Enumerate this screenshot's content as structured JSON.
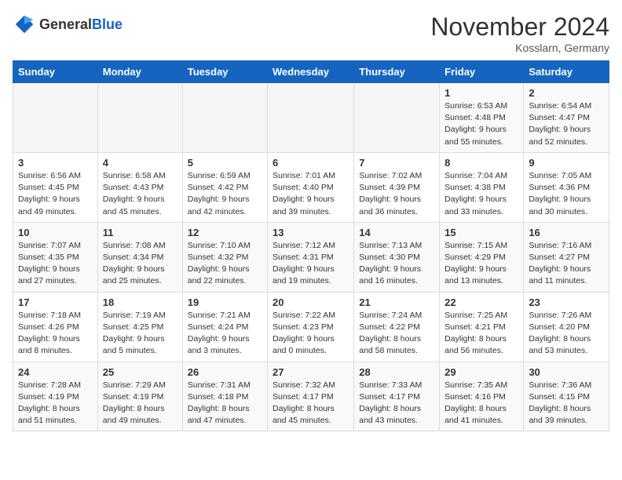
{
  "logo": {
    "general": "General",
    "blue": "Blue"
  },
  "title": "November 2024",
  "location": "Kosslarn, Germany",
  "weekdays": [
    "Sunday",
    "Monday",
    "Tuesday",
    "Wednesday",
    "Thursday",
    "Friday",
    "Saturday"
  ],
  "weeks": [
    [
      {
        "day": "",
        "info": ""
      },
      {
        "day": "",
        "info": ""
      },
      {
        "day": "",
        "info": ""
      },
      {
        "day": "",
        "info": ""
      },
      {
        "day": "",
        "info": ""
      },
      {
        "day": "1",
        "info": "Sunrise: 6:53 AM\nSunset: 4:48 PM\nDaylight: 9 hours and 55 minutes."
      },
      {
        "day": "2",
        "info": "Sunrise: 6:54 AM\nSunset: 4:47 PM\nDaylight: 9 hours and 52 minutes."
      }
    ],
    [
      {
        "day": "3",
        "info": "Sunrise: 6:56 AM\nSunset: 4:45 PM\nDaylight: 9 hours and 49 minutes."
      },
      {
        "day": "4",
        "info": "Sunrise: 6:58 AM\nSunset: 4:43 PM\nDaylight: 9 hours and 45 minutes."
      },
      {
        "day": "5",
        "info": "Sunrise: 6:59 AM\nSunset: 4:42 PM\nDaylight: 9 hours and 42 minutes."
      },
      {
        "day": "6",
        "info": "Sunrise: 7:01 AM\nSunset: 4:40 PM\nDaylight: 9 hours and 39 minutes."
      },
      {
        "day": "7",
        "info": "Sunrise: 7:02 AM\nSunset: 4:39 PM\nDaylight: 9 hours and 36 minutes."
      },
      {
        "day": "8",
        "info": "Sunrise: 7:04 AM\nSunset: 4:38 PM\nDaylight: 9 hours and 33 minutes."
      },
      {
        "day": "9",
        "info": "Sunrise: 7:05 AM\nSunset: 4:36 PM\nDaylight: 9 hours and 30 minutes."
      }
    ],
    [
      {
        "day": "10",
        "info": "Sunrise: 7:07 AM\nSunset: 4:35 PM\nDaylight: 9 hours and 27 minutes."
      },
      {
        "day": "11",
        "info": "Sunrise: 7:08 AM\nSunset: 4:34 PM\nDaylight: 9 hours and 25 minutes."
      },
      {
        "day": "12",
        "info": "Sunrise: 7:10 AM\nSunset: 4:32 PM\nDaylight: 9 hours and 22 minutes."
      },
      {
        "day": "13",
        "info": "Sunrise: 7:12 AM\nSunset: 4:31 PM\nDaylight: 9 hours and 19 minutes."
      },
      {
        "day": "14",
        "info": "Sunrise: 7:13 AM\nSunset: 4:30 PM\nDaylight: 9 hours and 16 minutes."
      },
      {
        "day": "15",
        "info": "Sunrise: 7:15 AM\nSunset: 4:29 PM\nDaylight: 9 hours and 13 minutes."
      },
      {
        "day": "16",
        "info": "Sunrise: 7:16 AM\nSunset: 4:27 PM\nDaylight: 9 hours and 11 minutes."
      }
    ],
    [
      {
        "day": "17",
        "info": "Sunrise: 7:18 AM\nSunset: 4:26 PM\nDaylight: 9 hours and 8 minutes."
      },
      {
        "day": "18",
        "info": "Sunrise: 7:19 AM\nSunset: 4:25 PM\nDaylight: 9 hours and 5 minutes."
      },
      {
        "day": "19",
        "info": "Sunrise: 7:21 AM\nSunset: 4:24 PM\nDaylight: 9 hours and 3 minutes."
      },
      {
        "day": "20",
        "info": "Sunrise: 7:22 AM\nSunset: 4:23 PM\nDaylight: 9 hours and 0 minutes."
      },
      {
        "day": "21",
        "info": "Sunrise: 7:24 AM\nSunset: 4:22 PM\nDaylight: 8 hours and 58 minutes."
      },
      {
        "day": "22",
        "info": "Sunrise: 7:25 AM\nSunset: 4:21 PM\nDaylight: 8 hours and 56 minutes."
      },
      {
        "day": "23",
        "info": "Sunrise: 7:26 AM\nSunset: 4:20 PM\nDaylight: 8 hours and 53 minutes."
      }
    ],
    [
      {
        "day": "24",
        "info": "Sunrise: 7:28 AM\nSunset: 4:19 PM\nDaylight: 8 hours and 51 minutes."
      },
      {
        "day": "25",
        "info": "Sunrise: 7:29 AM\nSunset: 4:19 PM\nDaylight: 8 hours and 49 minutes."
      },
      {
        "day": "26",
        "info": "Sunrise: 7:31 AM\nSunset: 4:18 PM\nDaylight: 8 hours and 47 minutes."
      },
      {
        "day": "27",
        "info": "Sunrise: 7:32 AM\nSunset: 4:17 PM\nDaylight: 8 hours and 45 minutes."
      },
      {
        "day": "28",
        "info": "Sunrise: 7:33 AM\nSunset: 4:17 PM\nDaylight: 8 hours and 43 minutes."
      },
      {
        "day": "29",
        "info": "Sunrise: 7:35 AM\nSunset: 4:16 PM\nDaylight: 8 hours and 41 minutes."
      },
      {
        "day": "30",
        "info": "Sunrise: 7:36 AM\nSunset: 4:15 PM\nDaylight: 8 hours and 39 minutes."
      }
    ]
  ]
}
